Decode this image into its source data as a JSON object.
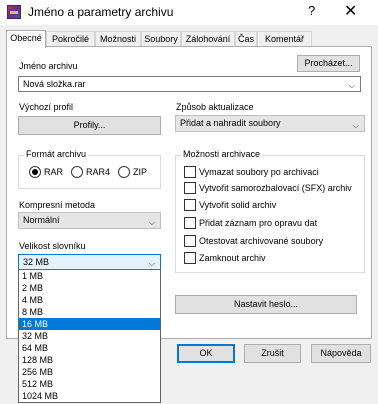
{
  "window": {
    "title": "Jméno a parametry archivu",
    "help": "?",
    "close": "✕"
  },
  "tabs": [
    {
      "label": "Obecné",
      "active": true
    },
    {
      "label": "Pokročilé",
      "active": false
    },
    {
      "label": "Možnosti",
      "active": false
    },
    {
      "label": "Soubory",
      "active": false
    },
    {
      "label": "Zálohování",
      "active": false
    },
    {
      "label": "Čas",
      "active": false
    },
    {
      "label": "Komentář",
      "active": false
    }
  ],
  "archive_name": {
    "label": "Jméno archivu",
    "value": "Nová složka.rar",
    "browse": "Procházet..."
  },
  "profile": {
    "label": "Výchozí profil",
    "button": "Profily..."
  },
  "update_mode": {
    "label": "Způsob aktualizace",
    "value": "Přidat a nahradit soubory"
  },
  "format": {
    "label": "Formát archivu",
    "options": [
      "RAR",
      "RAR4",
      "ZIP"
    ],
    "selected": "RAR"
  },
  "compression": {
    "label": "Kompresní metoda",
    "value": "Normální"
  },
  "dictionary": {
    "label": "Velikost slovníku",
    "value": "32 MB",
    "options": [
      "1 MB",
      "2 MB",
      "4 MB",
      "8 MB",
      "16 MB",
      "32 MB",
      "64 MB",
      "128 MB",
      "256 MB",
      "512 MB",
      "1024 MB"
    ],
    "highlighted": "16 MB"
  },
  "archiving_options": {
    "label": "Možnosti archivace",
    "items": [
      {
        "label": "Vymazat soubory po archivaci",
        "checked": false
      },
      {
        "label": "Vytvořit samorozbalovací (SFX) archiv",
        "checked": false
      },
      {
        "label": "Vytvořit solid archiv",
        "checked": false
      },
      {
        "label": "Přidat záznam pro opravu dat",
        "checked": false
      },
      {
        "label": "Otestovat archivované soubory",
        "checked": false
      },
      {
        "label": "Zamknout archiv",
        "checked": false
      }
    ]
  },
  "password_button": "Nastavit heslo...",
  "footer": {
    "ok": "OK",
    "cancel": "Zrušit",
    "help": "Nápověda"
  },
  "icons": {
    "app": "winrar-icon",
    "chevron": "chevron-down-icon"
  }
}
